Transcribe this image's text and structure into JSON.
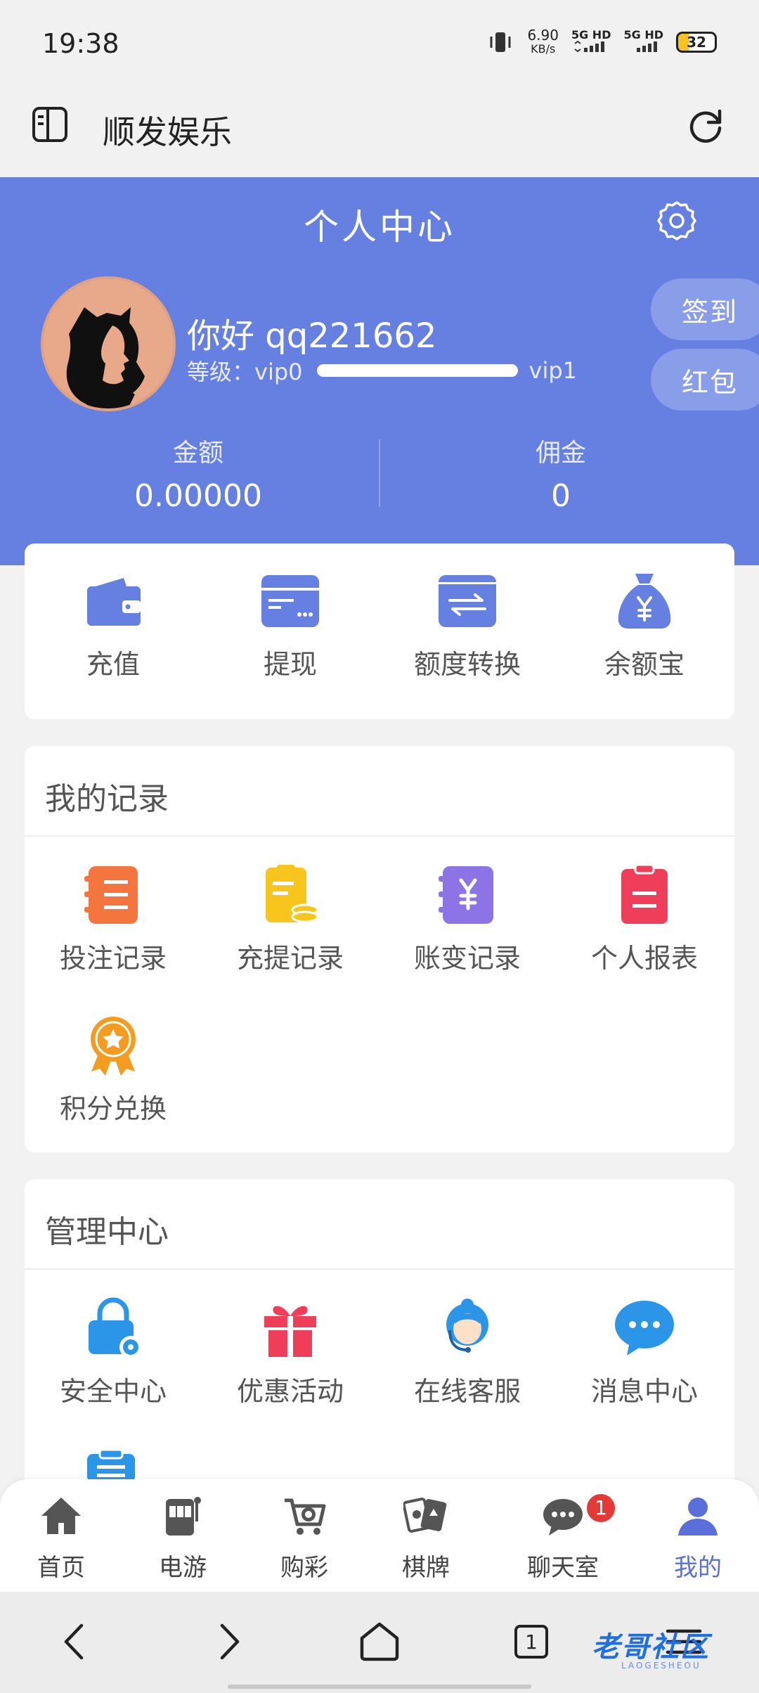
{
  "status_bar": {
    "time": "19:38",
    "net_speed": "6.90",
    "net_unit": "KB/s",
    "sim1": "5G HD",
    "sim2": "5G HD",
    "battery": "32"
  },
  "app_bar": {
    "title": "顺发娱乐",
    "icons": [
      "sidebar-icon",
      "refresh-icon"
    ]
  },
  "header": {
    "title": "个人中心",
    "greeting": "你好 qq221662",
    "level_label": "等级：vip0",
    "next_level": "vip1",
    "level_progress": 0,
    "signin_label": "签到",
    "redpacket_label": "红包",
    "balance_label": "金额",
    "balance_value": "0.00000",
    "commission_label": "佣金",
    "commission_value": "0"
  },
  "quick_actions": [
    {
      "label": "充值",
      "icon": "wallet-icon"
    },
    {
      "label": "提现",
      "icon": "card-icon"
    },
    {
      "label": "额度转换",
      "icon": "transfer-icon"
    },
    {
      "label": "余额宝",
      "icon": "money-bag-icon"
    }
  ],
  "records": {
    "title": "我的记录",
    "items": [
      {
        "label": "投注记录",
        "icon": "bet-record-icon"
      },
      {
        "label": "充提记录",
        "icon": "deposit-record-icon"
      },
      {
        "label": "账变记录",
        "icon": "ledger-icon"
      },
      {
        "label": "个人报表",
        "icon": "report-icon"
      },
      {
        "label": "积分兑换",
        "icon": "medal-icon"
      }
    ]
  },
  "management": {
    "title": "管理中心",
    "items": [
      {
        "label": "安全中心",
        "icon": "security-lock-icon"
      },
      {
        "label": "优惠活动",
        "icon": "gift-icon"
      },
      {
        "label": "在线客服",
        "icon": "customer-service-icon"
      },
      {
        "label": "消息中心",
        "icon": "chat-bubble-icon"
      }
    ]
  },
  "tab_bar": [
    {
      "label": "首页",
      "icon": "home-icon"
    },
    {
      "label": "电游",
      "icon": "slot-machine-icon"
    },
    {
      "label": "购彩",
      "icon": "lottery-cart-icon"
    },
    {
      "label": "棋牌",
      "icon": "cards-icon"
    },
    {
      "label": "聊天室",
      "icon": "chat-icon",
      "badge": "1"
    },
    {
      "label": "我的",
      "icon": "user-icon",
      "active": true
    }
  ],
  "browser_nav": {
    "tab_count": "1",
    "watermark": "老哥社区",
    "watermark_sub": "LAOGESHEOU"
  },
  "colors": {
    "header": "#6680e2",
    "accent": "#5a6fd9",
    "badge": "#e53935"
  }
}
